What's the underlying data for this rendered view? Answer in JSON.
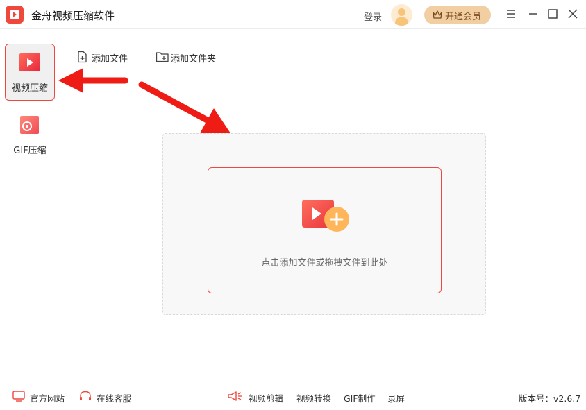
{
  "app": {
    "title": "金舟视频压缩软件"
  },
  "header": {
    "login": "登录",
    "vip_label": "开通会员"
  },
  "sidebar": {
    "items": [
      {
        "label": "视频压缩",
        "active": true
      },
      {
        "label": "GIF压缩",
        "active": false
      }
    ]
  },
  "toolbar": {
    "add_file": "添加文件",
    "add_folder": "添加文件夹"
  },
  "dropzone": {
    "hint": "点击添加文件或拖拽文件到此处"
  },
  "footer": {
    "official_site": "官方网站",
    "online_service": "在线客服",
    "links": [
      "视频剪辑",
      "视频转换",
      "GIF制作",
      "录屏"
    ],
    "version": "版本号：v2.6.7"
  },
  "colors": {
    "accent": "#f0473c",
    "vip_bg": "#f1cfa3",
    "annotation_arrow": "#ee1c14"
  }
}
